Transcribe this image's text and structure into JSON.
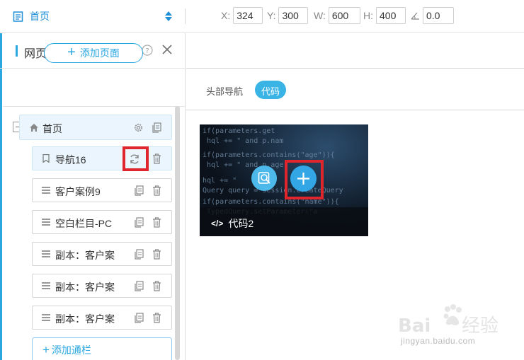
{
  "topbar": {
    "page_name": "首页",
    "x_label": "X:",
    "x_value": "324",
    "y_label": "Y:",
    "y_value": "300",
    "w_label": "W:",
    "w_value": "600",
    "h_label": "H:",
    "h_value": "400",
    "angle_value": "0.0"
  },
  "panel": {
    "title": "网页",
    "add_page_label": "添加页面",
    "root": {
      "label": "首页"
    },
    "nodes": [
      {
        "label": "导航16",
        "icon": "bookmark-icon"
      },
      {
        "label": "客户案例9",
        "icon": "menu-lines-icon"
      },
      {
        "label": "空白栏目-PC",
        "icon": "menu-lines-icon"
      },
      {
        "label": "副本：客户案",
        "icon": "menu-lines-icon"
      },
      {
        "label": "副本：客户案",
        "icon": "menu-lines-icon"
      },
      {
        "label": "副本：客户案",
        "icon": "menu-lines-icon"
      }
    ],
    "add_column_label": "添加通栏"
  },
  "tabs": [
    {
      "label": "头部导航"
    },
    {
      "label": "代码"
    }
  ],
  "thumbnail": {
    "caption": "代码2",
    "caption_icon": "</>"
  },
  "watermark": {
    "text": "Baidu经验",
    "url": "jingyan.baidu.com"
  },
  "colors": {
    "accent": "#2ba7e0",
    "highlight": "#e0262c",
    "active_tab": "#39b4e5"
  }
}
